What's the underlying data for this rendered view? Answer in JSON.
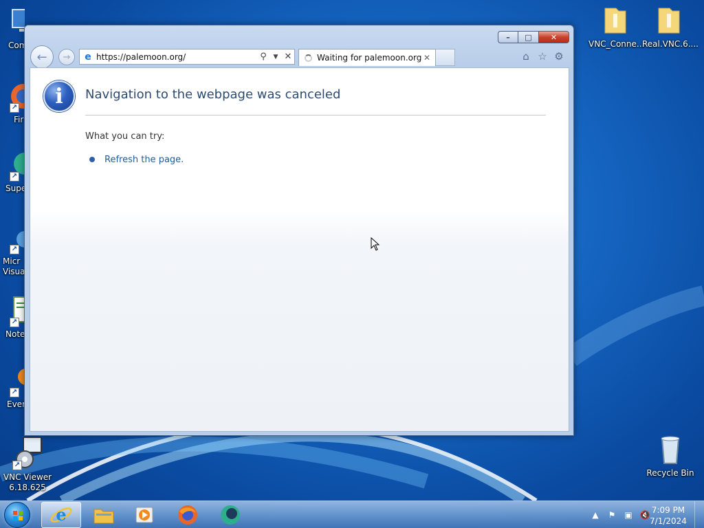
{
  "desktop": {
    "icons_left": [
      {
        "label": "Com",
        "icon": "computer-icon"
      },
      {
        "label": "Fir",
        "icon": "firefox-icon"
      },
      {
        "label": "Supe",
        "icon": "app-icon"
      },
      {
        "label": "Micr\nVisual",
        "icon": "app-icon"
      },
      {
        "label": "Note",
        "icon": "notepad-icon"
      },
      {
        "label": "Ever",
        "icon": "app-icon"
      },
      {
        "label": "VNC Viewer\n6.18.625",
        "icon": "vnc-viewer-icon"
      }
    ],
    "icons_right": [
      {
        "label": "VNC_Conne...",
        "icon": "zip-folder-icon"
      },
      {
        "label": "Real.VNC.6....",
        "icon": "zip-folder-icon"
      },
      {
        "label": "Recycle Bin",
        "icon": "recycle-bin-icon"
      }
    ]
  },
  "browser": {
    "address": "https://palemoon.org/",
    "tab_title": "Waiting for palemoon.org",
    "caption": {
      "min": "–",
      "max": "□",
      "close": "✕"
    },
    "error": {
      "title": "Navigation to the webpage was canceled",
      "try_label": "What you can try:",
      "refresh_link": "Refresh the page."
    }
  },
  "taskbar": {
    "apps": [
      {
        "name": "internet-explorer",
        "active": true
      },
      {
        "name": "file-explorer",
        "active": false
      },
      {
        "name": "media-player",
        "active": false
      },
      {
        "name": "firefox",
        "active": false
      },
      {
        "name": "app",
        "active": false
      }
    ],
    "clock_time": "7:09 PM",
    "clock_date": "7/1/2024"
  },
  "colors": {
    "accent": "#1f5c99",
    "title_text": "#2c4a70"
  }
}
